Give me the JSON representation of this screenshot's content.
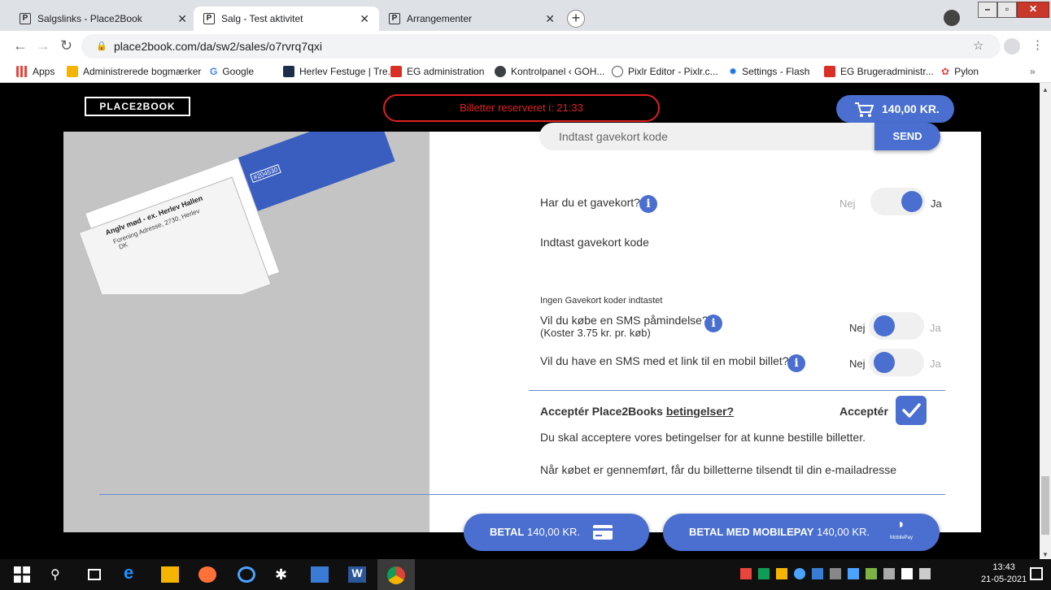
{
  "tabs": [
    {
      "title": "Salgslinks - Place2Book",
      "active": false
    },
    {
      "title": "Salg - Test aktivitet",
      "active": true
    },
    {
      "title": "Arrangementer",
      "active": false
    }
  ],
  "address": {
    "url": "place2book.com/da/sw2/sales/o7rvrq7qxi"
  },
  "bookmarks": [
    {
      "label": "Apps",
      "color": "#e8453c"
    },
    {
      "label": "Administrerede bogmærker",
      "color": "#f4b400"
    },
    {
      "label": "Google",
      "color": "#4285f4"
    },
    {
      "label": "Herlev Festuge | Tre...",
      "color": "#1e2d4a"
    },
    {
      "label": "EG administration",
      "color": "#d93025"
    },
    {
      "label": "Kontrolpanel ‹ GOH...",
      "color": "#3c4043"
    },
    {
      "label": "Pixlr Editor - Pixlr.c...",
      "color": "#555555"
    },
    {
      "label": "Settings - Flash",
      "color": "#1a73e8"
    },
    {
      "label": "EG Brugeradministr...",
      "color": "#d93025"
    },
    {
      "label": "Pylon",
      "color": "#e8453c"
    }
  ],
  "header": {
    "logo": "PLACE2BOOK",
    "timer": "Billetter reserveret i: 21:33",
    "cart": "140,00 KR."
  },
  "form": {
    "giftcard_question": "Har du et gavekort?",
    "giftcard_toggle": {
      "no": "Nej",
      "yes": "Ja",
      "value": "Ja"
    },
    "giftcard_code_label": "Indtast gavekort kode",
    "giftcard_placeholder": "Indtast gavekort kode",
    "send_label": "SEND",
    "no_codes_text": "Ingen Gavekort koder indtastet",
    "sms_reminder_question": "Vil du købe en SMS påmindelse?",
    "sms_reminder_price": "(Koster 3.75 kr. pr. køb)",
    "sms_reminder_toggle": {
      "no": "Nej",
      "yes": "Ja",
      "value": "Nej"
    },
    "sms_link_question": "Vil du have en SMS med et link til en mobil billet?",
    "sms_link_toggle": {
      "no": "Nej",
      "yes": "Ja",
      "value": "Nej"
    },
    "terms_prefix": "Acceptér Place2Books ",
    "terms_link": "betingelser?",
    "accept_label": "Acceptér",
    "accept_checked": true,
    "terms_notice": "Du skal acceptere vores betingelser for at kunne bestille billetter.",
    "email_notice": "Når købet er gennemført, får du billetterne tilsendt til din e-mailadresse"
  },
  "payment": {
    "pay_bold": "BETAL",
    "pay_amount": " 140,00 KR.",
    "mobilepay_bold": "BETAL MED MOBILEPAY",
    "mobilepay_amount": " 140,00 KR.",
    "mobilepay_logo_text": "MobilePay"
  },
  "ticket_image": {
    "line1": "Anglv mød - ex. Herlev Hallen",
    "line2": "Forening Adresse, 2730, Herlev",
    "line3": "DK",
    "number": "#204530"
  },
  "taskbar": {
    "time": "13:43",
    "date": "21-05-2021"
  },
  "colors": {
    "accent": "#4a6fd0",
    "timer_red": "#e02020"
  }
}
